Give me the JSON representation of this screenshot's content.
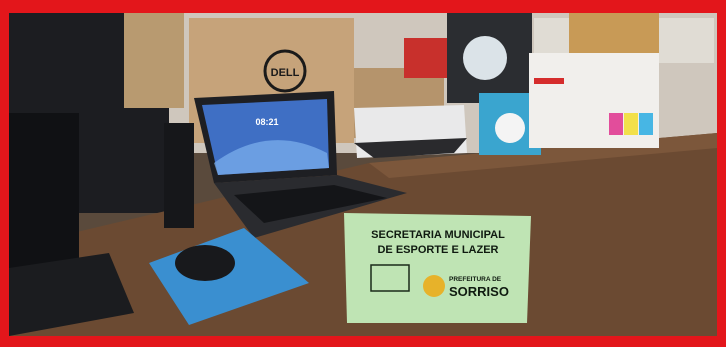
{
  "photo": {
    "subject_icons": [
      "laptop-icon",
      "printer-icon",
      "router-box-icon",
      "mouse-icon",
      "keyboard-icon",
      "mini-pc-icon",
      "monitor-icon"
    ],
    "laptop_screen_time": "08:21",
    "box_brand": "DELL"
  },
  "sign": {
    "line1": "SECRETARIA MUNICIPAL",
    "line2": "DE ESPORTE E LAZER",
    "logo_text_top": "PREFEITURA DE",
    "logo_text_main": "SORRISO"
  },
  "colors": {
    "frame": "#e3161b",
    "sign_background": "#bfe4b4",
    "mousepad": "#3a8fd0",
    "table": "#6b4a32"
  }
}
